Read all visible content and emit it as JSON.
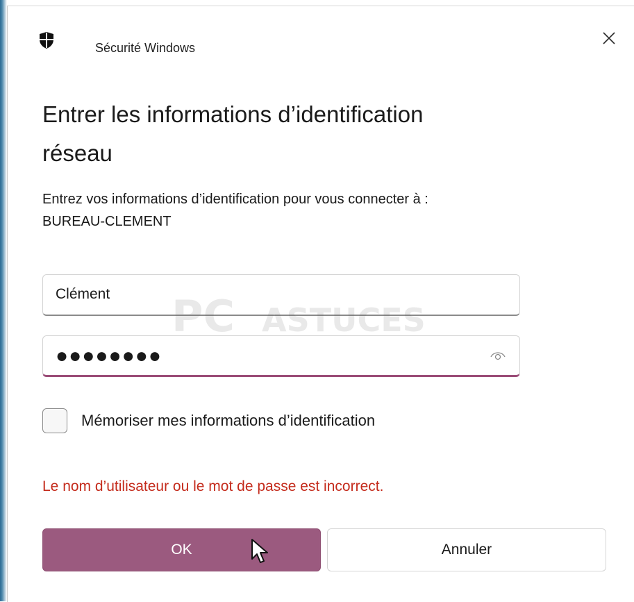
{
  "window": {
    "app_title": "Sécurité Windows",
    "close_glyph": "✕"
  },
  "dialog": {
    "heading_line1": "Entrer les informations d’identification",
    "heading_line2": "réseau",
    "description_line1": "Entrez vos informations d’identification pour vous connecter à :",
    "description_line2": "BUREAU-CLEMENT"
  },
  "form": {
    "username_value": "Clément",
    "password_mask": "●●●●●●●●",
    "password_length": 8,
    "remember_label": "Mémoriser mes informations d’identification",
    "remember_checked": false
  },
  "error": {
    "message": "Le nom d’utilisateur ou le mot de passe est incorrect."
  },
  "buttons": {
    "ok_label": "OK",
    "cancel_label": "Annuler"
  },
  "watermark": {
    "text": "PC ASTUCES"
  },
  "colors": {
    "accent": "#9b5a7f",
    "error": "#c42b1c"
  },
  "icons": {
    "app": "shield-icon",
    "close": "close-icon",
    "reveal": "eye-icon",
    "pointer": "mouse-cursor-icon"
  }
}
